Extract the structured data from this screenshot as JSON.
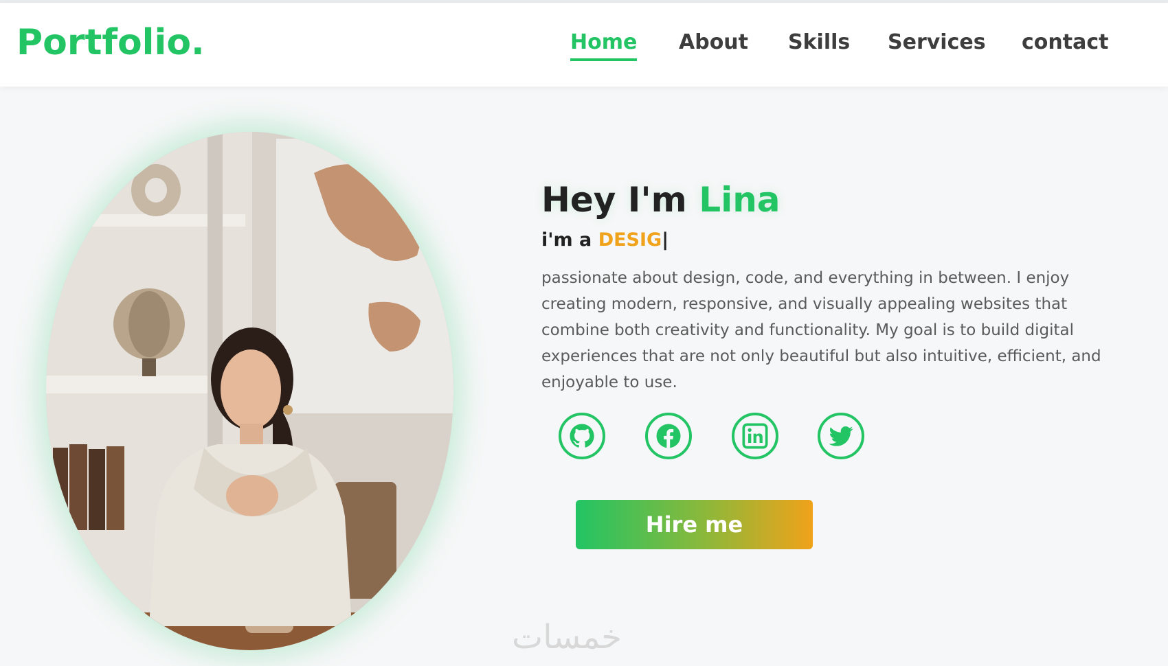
{
  "header": {
    "logo": "Portfolio.",
    "nav": [
      {
        "label": "Home",
        "active": true
      },
      {
        "label": "About",
        "active": false
      },
      {
        "label": "Skills",
        "active": false
      },
      {
        "label": "Services",
        "active": false
      },
      {
        "label": "contact",
        "active": false
      }
    ]
  },
  "hero": {
    "title_prefix": "Hey I'm",
    "name": "Lina",
    "subtitle_prefix": "i'm a",
    "role_typed": "DESIG",
    "cursor": "|",
    "description": "passionate about design, code, and everything in between. I enjoy creating modern, responsive, and visually appealing websites that combine both creativity and functionality. My goal is to build digital experiences that are not only beautiful but also intuitive, efficient, and enjoyable to use.",
    "social_icons": [
      "github-icon",
      "facebook-icon",
      "linkedin-icon",
      "twitter-icon"
    ],
    "hire_button": "Hire me"
  },
  "watermark": "خمسات",
  "colors": {
    "accent_green": "#22c464",
    "accent_orange": "#f0a21a",
    "text_dark": "#222222",
    "text_body": "#5a5a5a"
  }
}
